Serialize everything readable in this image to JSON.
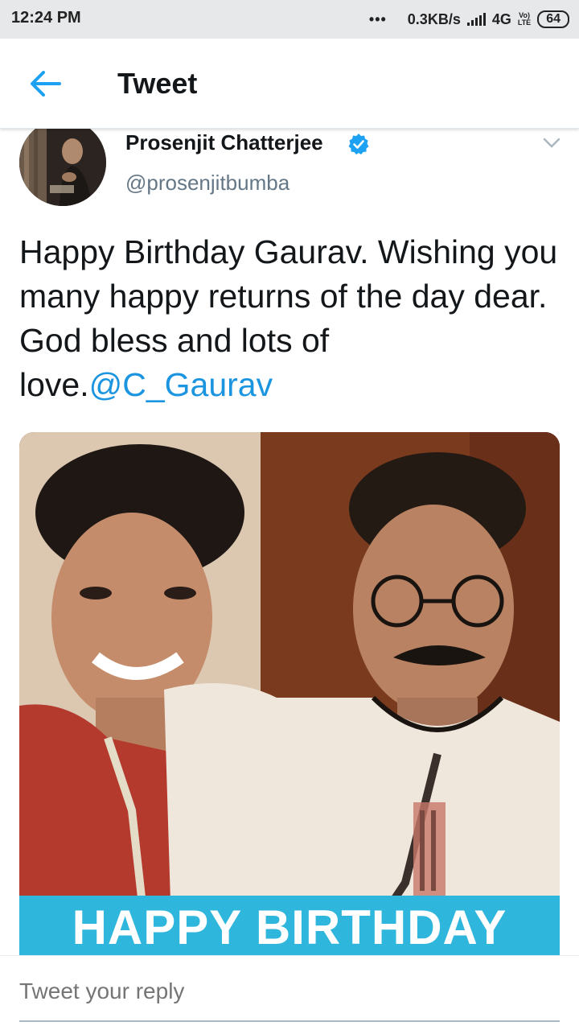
{
  "status_bar": {
    "time": "12:24 PM",
    "dots": "•••",
    "speed": "0.3KB/s",
    "network": "4G",
    "volte_top": "Vo)",
    "volte_bottom": "LTE",
    "battery": "64"
  },
  "app_bar": {
    "title": "Tweet",
    "back_icon": "arrow-left-icon"
  },
  "tweet": {
    "author_name": "Prosenjit Chatterjee",
    "handle": "@prosenjitbumba",
    "verified": true,
    "text": "Happy Birthday Gaurav. Wishing you many happy returns of the day dear. God bless and lots of love.",
    "mention": "@C_Gaurav",
    "media_banner_text": "HAPPY BIRTHDAY"
  },
  "reply": {
    "placeholder": "Tweet your reply"
  },
  "colors": {
    "accent": "#1b95e0",
    "banner": "#2fb6dc",
    "secondary_text": "#657786"
  }
}
